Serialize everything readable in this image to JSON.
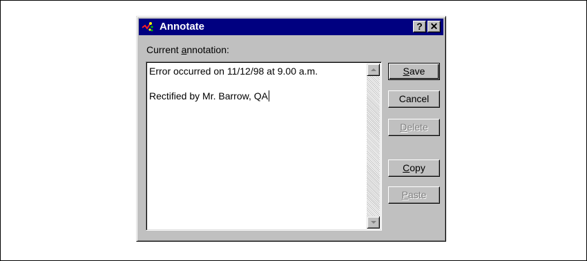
{
  "dialog": {
    "title": "Annotate",
    "help_button": "?",
    "close_button": "✕",
    "label_prefix": "Current ",
    "label_mnemonic": "a",
    "label_suffix": "nnotation:"
  },
  "annotation": {
    "line1": "Error occurred on 11/12/98 at 9.00 a.m.",
    "line2": "Rectified by Mr. Barrow, QA"
  },
  "buttons": {
    "save": {
      "mnemonic": "S",
      "rest": "ave",
      "enabled": true
    },
    "cancel": {
      "label": "Cancel",
      "enabled": true
    },
    "delete": {
      "mnemonic": "D",
      "rest": "elete",
      "enabled": false
    },
    "copy": {
      "mnemonic": "C",
      "rest": "opy",
      "enabled": true
    },
    "paste": {
      "mnemonic": "P",
      "rest": "aste",
      "enabled": false
    }
  },
  "colors": {
    "title_bar": "#000080",
    "dialog_face": "#c0c0c0",
    "disabled_text": "#808080"
  },
  "icons": {
    "app_icon": "annotate-app-icon",
    "scroll_up": "arrow-up-icon",
    "scroll_down": "arrow-down-icon"
  }
}
